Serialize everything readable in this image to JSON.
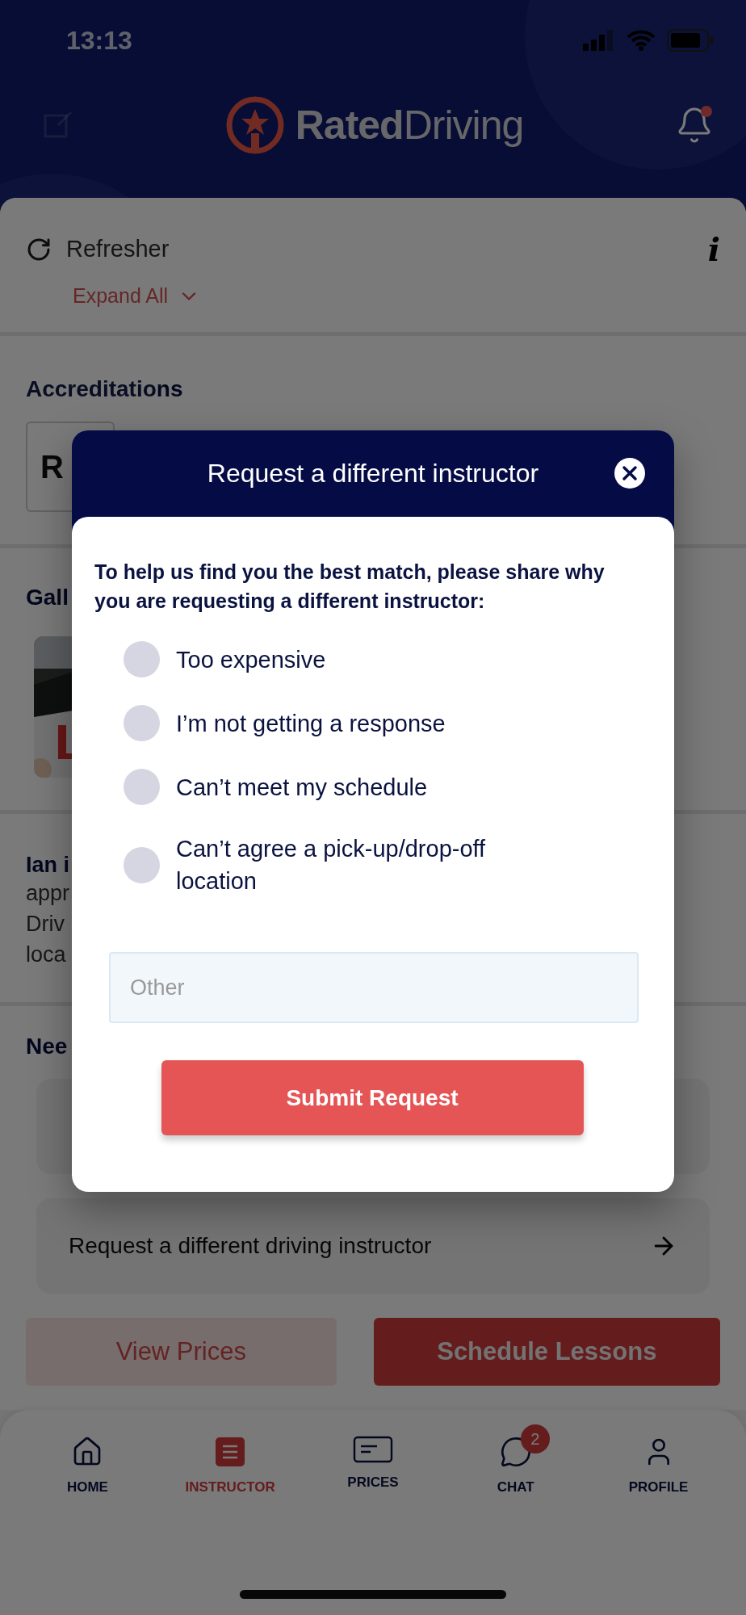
{
  "status_bar": {
    "time": "13:13"
  },
  "header": {
    "logo_bold": "Rated",
    "logo_light": "Driving",
    "notification": true
  },
  "course": {
    "title": "Refresher",
    "expand_label": "Expand All",
    "info_label": "i"
  },
  "accreditations": {
    "title": "Accreditations",
    "card_text": "R"
  },
  "gallery": {
    "title": "Gall"
  },
  "about": {
    "heading": "Ian i",
    "lines": [
      "appr",
      "Driv",
      "loca"
    ]
  },
  "help": {
    "title": "Nee",
    "links": [
      {
        "label": "Request a different driving instructor"
      }
    ]
  },
  "actions": [
    {
      "label": "View Prices",
      "kind": "secondary"
    },
    {
      "label": "Schedule Lessons",
      "kind": "primary"
    }
  ],
  "nav": [
    {
      "label": "HOME",
      "kind": "home",
      "selected": false
    },
    {
      "label": "INSTRUCTOR",
      "kind": "instructor",
      "selected": true
    },
    {
      "label": "PRICES",
      "kind": "prices",
      "selected": false
    },
    {
      "label": "CHAT",
      "kind": "chat",
      "selected": false,
      "badge": "2"
    },
    {
      "label": "PROFILE",
      "kind": "profile",
      "selected": false
    }
  ],
  "modal": {
    "title": "Request a different instructor",
    "question": "To help us find you the best match, please share why you are requesting a different instructor:",
    "options": [
      {
        "label": "Too expensive",
        "selected": false
      },
      {
        "label": "I’m not getting a response",
        "selected": false
      },
      {
        "label": "Can’t meet my schedule",
        "selected": false
      },
      {
        "label": "Can’t agree a pick-up/drop-off location",
        "selected": false
      }
    ],
    "other_placeholder": "Other",
    "submit": "Submit Request"
  }
}
